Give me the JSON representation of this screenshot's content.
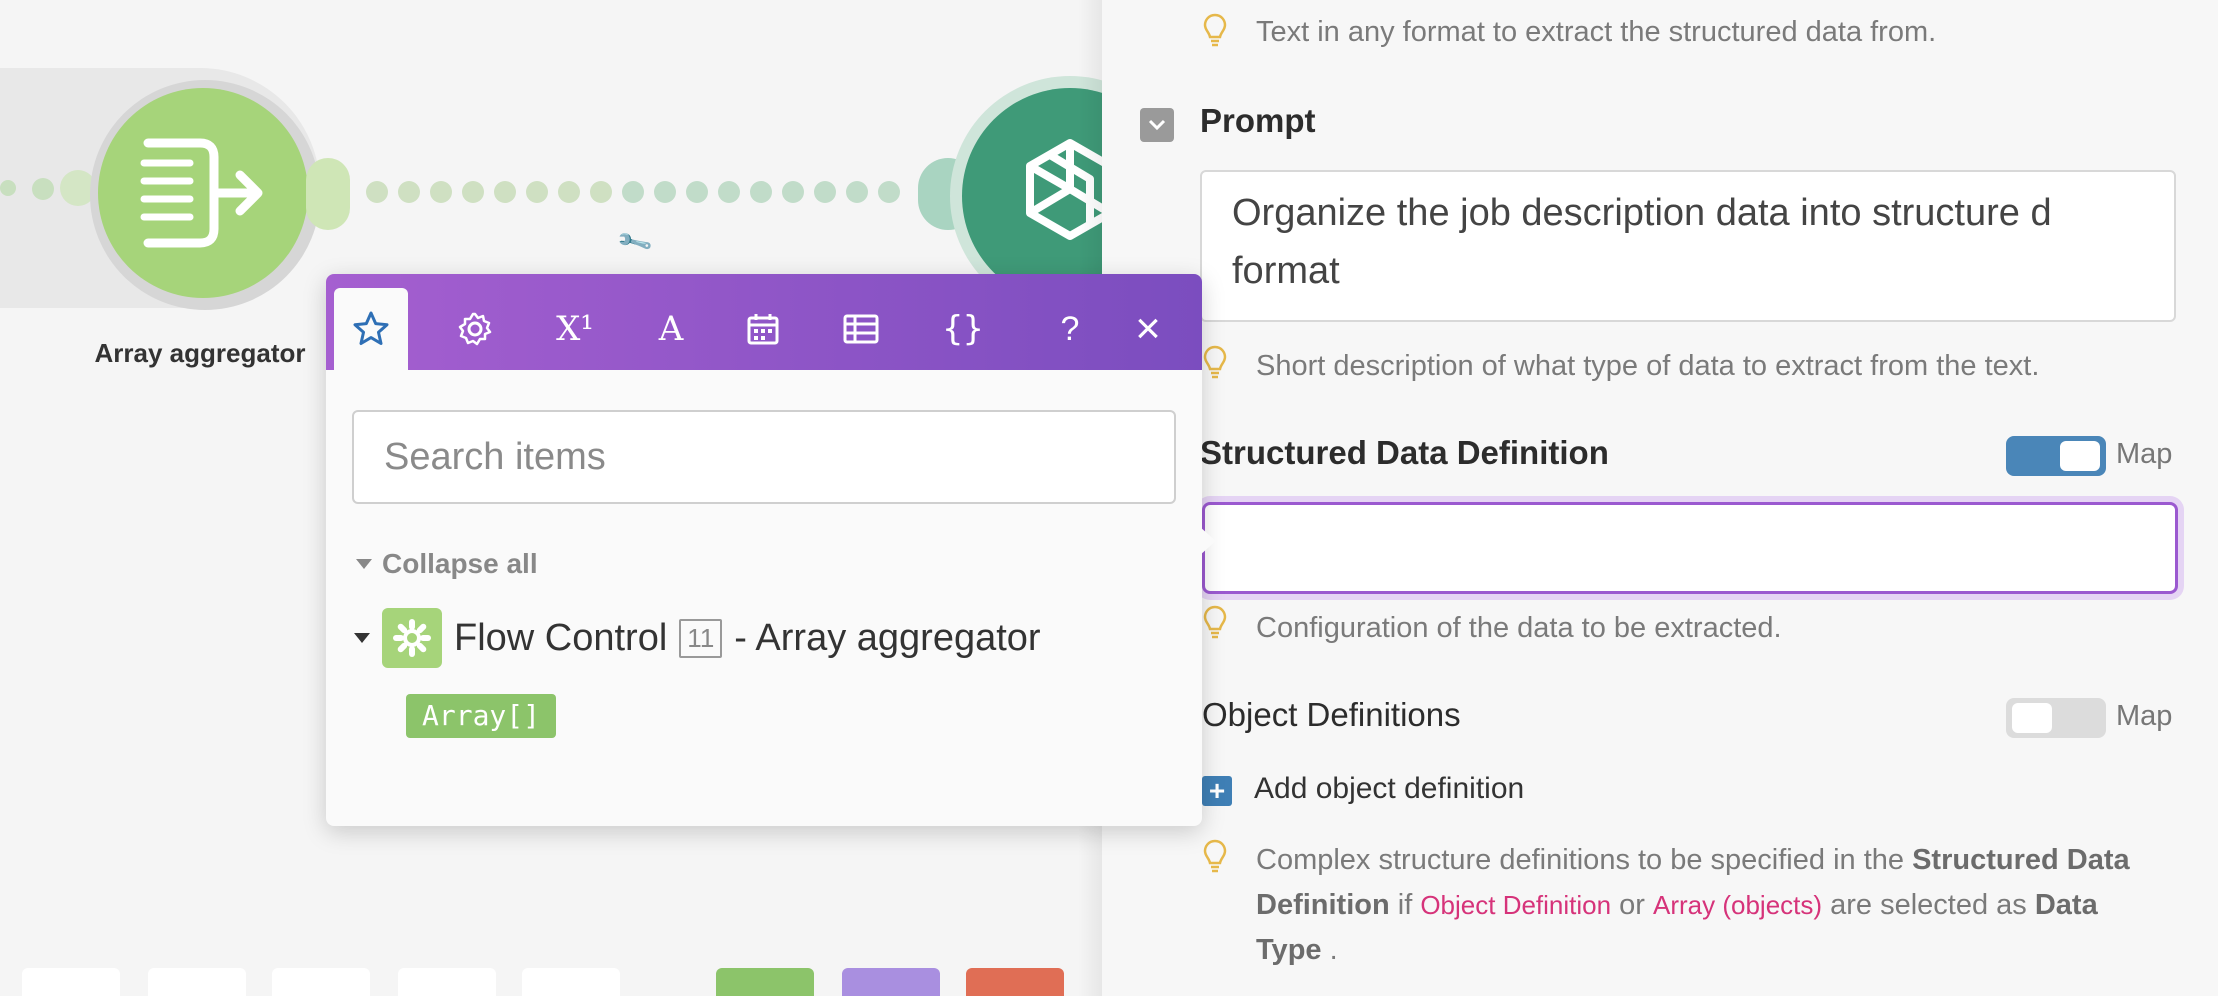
{
  "canvas": {
    "aggregator_label": "Array aggregator"
  },
  "popup": {
    "search_placeholder": "Search items",
    "collapse_all_label": "Collapse all",
    "toolbar": {
      "help_label": "?",
      "close_label": "×",
      "superscript_label": "X¹",
      "text_label": "A",
      "json_label": "{}"
    },
    "tree": {
      "module_name": "Flow Control",
      "module_number": "11",
      "module_suffix": "- Array aggregator",
      "item_label": "Array[]"
    }
  },
  "panel": {
    "text_hint": "Text in any format to extract the structured data from.",
    "prompt_title": "Prompt",
    "prompt_value": "Organize the job description data into structure d format",
    "prompt_hint": "Short description of what type of data to extract from the text.",
    "sdd_title": "Structured Data Definition",
    "sdd_map_label": "Map",
    "sdd_hint": "Configuration of the data to be extracted.",
    "od_title": "Object Definitions",
    "od_map_label": "Map",
    "add_object_label": "Add object definition",
    "complex": {
      "part1": "Complex structure definitions to be specified in the",
      "bold1": "Structured Data Definition",
      "part2": "if",
      "pink1": "Object Definition",
      "part3": "or",
      "pink2": "Array (objects)",
      "part4": "are selected as",
      "bold2": "Data Type",
      "part5": "."
    }
  },
  "colors": {
    "accent_purple": "#9b59d0",
    "toggle_on": "#4a86b8",
    "module_green": "#a6d47a",
    "openai_green": "#3f9a78",
    "hint_bulb": "#e6b84a"
  }
}
